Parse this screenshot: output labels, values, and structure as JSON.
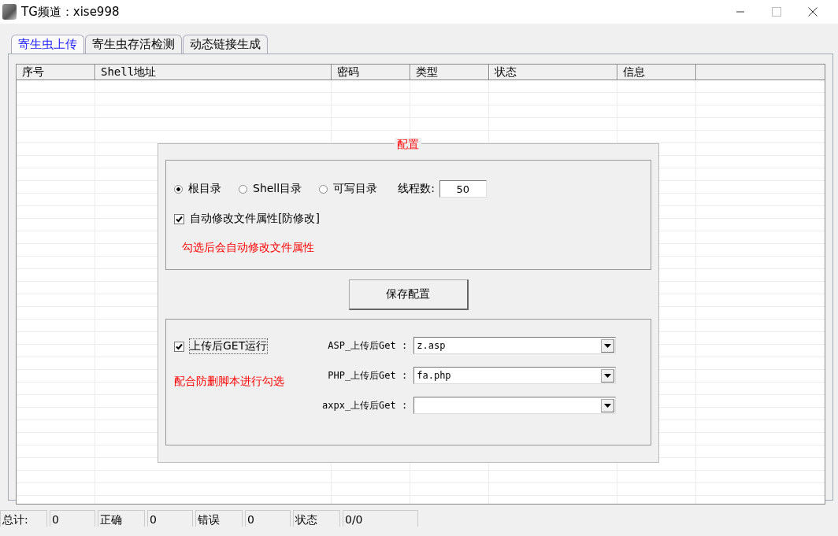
{
  "window": {
    "title": "TG频道：xise998"
  },
  "tabs": [
    {
      "label": "寄生虫上传",
      "selected": true
    },
    {
      "label": "寄生虫存活检测",
      "selected": false
    },
    {
      "label": "动态链接生成",
      "selected": false
    }
  ],
  "table": {
    "columns": [
      "序号",
      "Shell地址",
      "密码",
      "类型",
      "状态",
      "信息"
    ]
  },
  "config": {
    "title": "配置",
    "directory_options": [
      {
        "label": "根目录",
        "selected": true
      },
      {
        "label": "Shell目录",
        "selected": false
      },
      {
        "label": "可写目录",
        "selected": false
      }
    ],
    "threads": {
      "label": "线程数:",
      "value": "50"
    },
    "auto_modify": {
      "label": "自动修改文件属性[防修改]",
      "checked": true
    },
    "auto_modify_hint": "勾选后会自动修改文件属性",
    "save_button": "保存配置",
    "get_run": {
      "label": "上传后GET运行",
      "checked": true
    },
    "get_run_hint": "配合防删脚本进行勾选",
    "get_fields": [
      {
        "label": "ASP_上传后Get :",
        "value": "z.asp"
      },
      {
        "label": "PHP_上传后Get :",
        "value": "fa.php"
      },
      {
        "label": "axpx_上传后Get :"
      }
    ]
  },
  "status_bar": [
    {
      "label": "总计:",
      "value": "0"
    },
    {
      "label": "正确",
      "value": "0"
    },
    {
      "label": "错误",
      "value": "0"
    },
    {
      "label": "状态",
      "value": "0/0"
    }
  ]
}
